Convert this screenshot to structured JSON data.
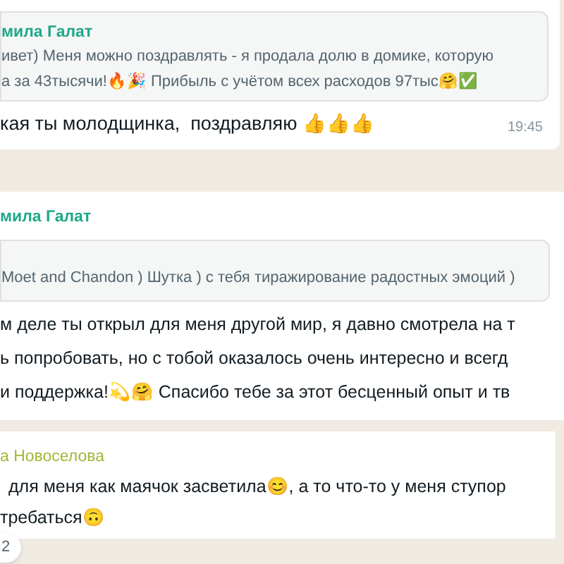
{
  "messages": [
    {
      "quote": {
        "sender": "мила Галат",
        "lines": [
          "ивет) Меня можно поздравлять - я продала долю в домике, которую",
          "а за 43тысячи!🔥🎉 Прибыль с учётом всех расходов 97тыс🤗✅"
        ]
      },
      "lines": [
        "кая ты молодщинка,  поздравляю 👍👍👍"
      ],
      "time": "19:45"
    },
    {
      "sender": "мила Галат",
      "quote": {
        "lines": [
          "Moet and Chandon ) Шутка ) с тебя тиражирование радостных эмоций )"
        ]
      },
      "lines": [
        "м деле ты открыл для меня другой мир, я давно смотрела на т",
        "ь попробовать, но с тобой оказалось очень интересно и всегд",
        "и поддержка!💫🤗 Спасибо тебе за этот бесценный опыт и тв"
      ]
    },
    {
      "sender": "а Новоселова",
      "lines": [
        "для меня как маячок засветила😊, а то что-то у меня ступор",
        "требаться🙃"
      ],
      "reaction": "2"
    }
  ]
}
